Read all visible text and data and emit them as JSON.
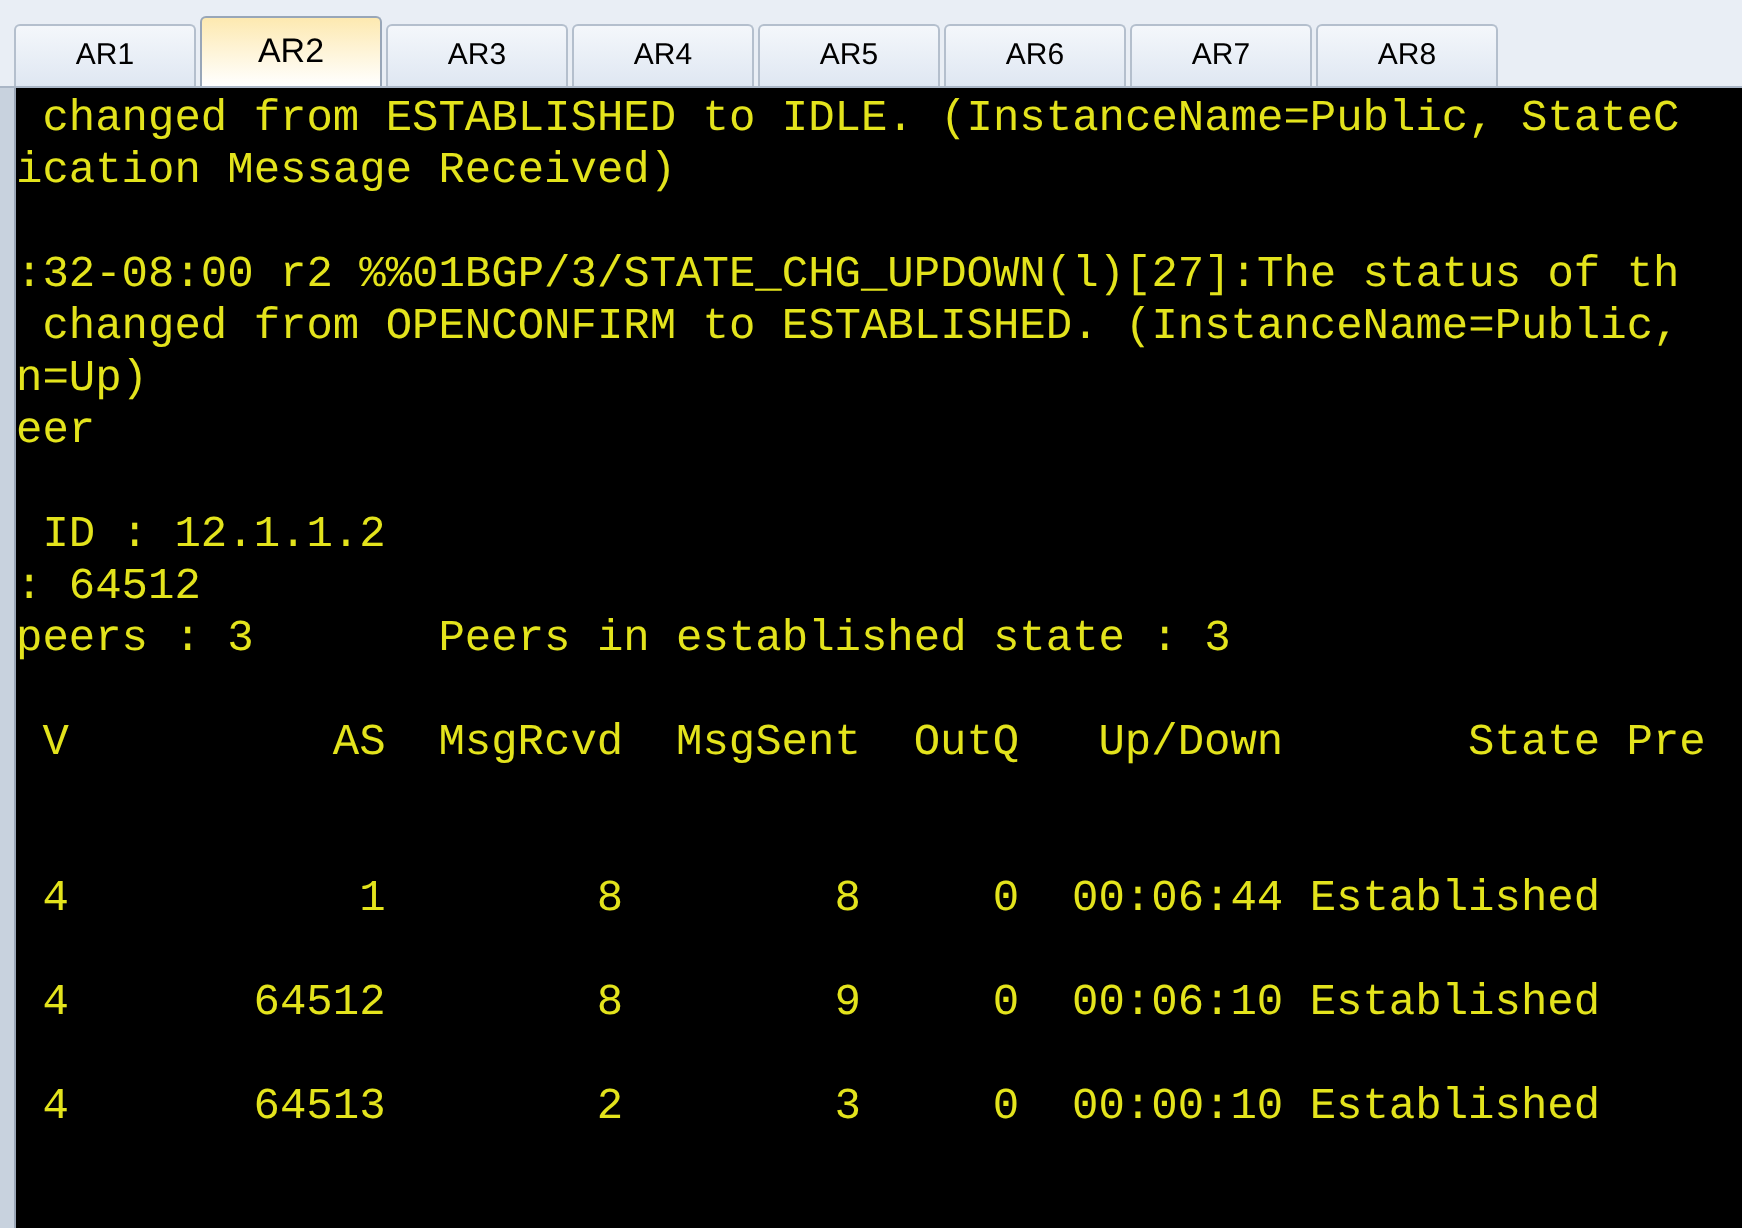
{
  "tabs": [
    {
      "label": "AR1",
      "selected": false
    },
    {
      "label": "AR2",
      "selected": true
    },
    {
      "label": "AR3",
      "selected": false
    },
    {
      "label": "AR4",
      "selected": false
    },
    {
      "label": "AR5",
      "selected": false
    },
    {
      "label": "AR6",
      "selected": false
    },
    {
      "label": "AR7",
      "selected": false
    },
    {
      "label": "AR8",
      "selected": false
    }
  ],
  "terminal": {
    "log_blocks": [
      [
        " changed from ESTABLISHED to IDLE. (InstanceName=Public, StateC",
        "ication Message Received)"
      ],
      [
        ":32-08:00 r2 %%01BGP/3/STATE_CHG_UPDOWN(l)[27]:The status of th",
        " changed from OPENCONFIRM to ESTABLISHED. (InstanceName=Public,",
        "n=Up)",
        "eer"
      ],
      [
        " ID : 12.1.1.2",
        ": 64512",
        "peers : 3       Peers in established state : 3"
      ]
    ],
    "table": {
      "columns": [
        "V",
        "AS",
        "MsgRcvd",
        "MsgSent",
        "OutQ",
        "Up/Down",
        "State",
        "Pre"
      ],
      "rows": [
        [
          "4",
          "1",
          "8",
          "8",
          "0",
          "00:06:44",
          "Established"
        ],
        [
          "4",
          "64512",
          "8",
          "9",
          "0",
          "00:06:10",
          "Established"
        ],
        [
          "4",
          "64513",
          "2",
          "3",
          "0",
          "00:00:10",
          "Established"
        ]
      ]
    }
  }
}
